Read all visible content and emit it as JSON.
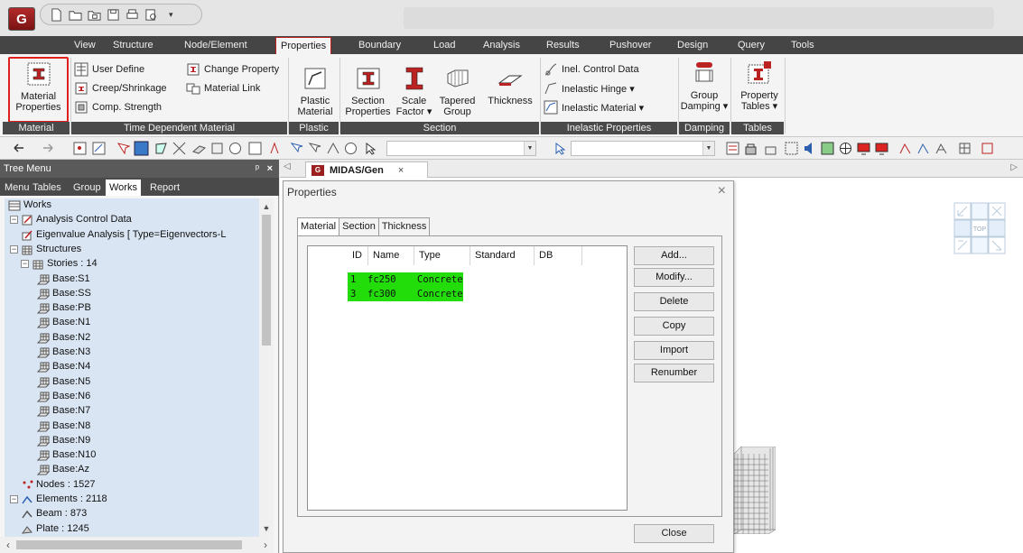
{
  "app": {
    "logo_text": "G",
    "title": ""
  },
  "quick_access": {
    "icons": [
      "new-file-icon",
      "open-folder-icon",
      "open-project-icon",
      "save-icon",
      "print-icon",
      "print-preview-icon"
    ],
    "more": "▾"
  },
  "ribbon_tabs": [
    "View",
    "Structure",
    "Node/Element",
    "Properties",
    "Boundary",
    "Load",
    "Analysis",
    "Results",
    "Pushover",
    "Design",
    "Query",
    "Tools"
  ],
  "ribbon": {
    "material_group": {
      "label": "Material",
      "btn_line1": "Material",
      "btn_line2": "Properties"
    },
    "time_dependent": {
      "label": "Time Dependent Material",
      "user_define": "User Define",
      "creep": "Creep/Shrinkage",
      "comp_strength": "Comp. Strength",
      "change_property": "Change Property",
      "material_link": "Material Link"
    },
    "plastic": {
      "label": "Plastic",
      "btn_line1": "Plastic",
      "btn_line2": "Material"
    },
    "section": {
      "label": "Section",
      "section_props_1": "Section",
      "section_props_2": "Properties",
      "scale_1": "Scale",
      "scale_2": "Factor ▾",
      "tapered_1": "Tapered",
      "tapered_2": "Group",
      "thickness": "Thickness"
    },
    "inelastic": {
      "label": "Inelastic Properties",
      "control": "Inel. Control Data",
      "hinge": "Inelastic Hinge ▾",
      "material": "Inelastic Material ▾"
    },
    "damping": {
      "label": "Damping",
      "btn_line1": "Group",
      "btn_line2": "Damping ▾"
    },
    "tables": {
      "label": "Tables",
      "btn_line1": "Property",
      "btn_line2": "Tables ▾"
    }
  },
  "tree_panel": {
    "title": "Tree Menu",
    "pin": "ᵖ",
    "close": "×",
    "tabs": [
      "Menu",
      "Tables",
      "Group",
      "Works",
      "Report"
    ],
    "active_tab": "Works",
    "nodes": [
      {
        "text": "Works",
        "level": 0,
        "icon": "works-icon",
        "expander": ""
      },
      {
        "text": "Analysis Control Data",
        "level": 1,
        "icon": "analysis-control-icon",
        "expander": "−"
      },
      {
        "text": "Eigenvalue Analysis [ Type=Eigenvectors-L",
        "level": 2,
        "icon": "eigenvalue-icon",
        "expander": ""
      },
      {
        "text": "Structures",
        "level": 1,
        "icon": "structures-icon",
        "expander": "−"
      },
      {
        "text": "Stories : 14",
        "level": 2,
        "icon": "stories-icon",
        "expander": "−"
      },
      {
        "text": "Base:S1",
        "level": 3,
        "icon": "story-icon",
        "expander": ""
      },
      {
        "text": "Base:SS",
        "level": 3,
        "icon": "story-icon",
        "expander": ""
      },
      {
        "text": "Base:PB",
        "level": 3,
        "icon": "story-icon",
        "expander": ""
      },
      {
        "text": "Base:N1",
        "level": 3,
        "icon": "story-icon",
        "expander": ""
      },
      {
        "text": "Base:N2",
        "level": 3,
        "icon": "story-icon",
        "expander": ""
      },
      {
        "text": "Base:N3",
        "level": 3,
        "icon": "story-icon",
        "expander": ""
      },
      {
        "text": "Base:N4",
        "level": 3,
        "icon": "story-icon",
        "expander": ""
      },
      {
        "text": "Base:N5",
        "level": 3,
        "icon": "story-icon",
        "expander": ""
      },
      {
        "text": "Base:N6",
        "level": 3,
        "icon": "story-icon",
        "expander": ""
      },
      {
        "text": "Base:N7",
        "level": 3,
        "icon": "story-icon",
        "expander": ""
      },
      {
        "text": "Base:N8",
        "level": 3,
        "icon": "story-icon",
        "expander": ""
      },
      {
        "text": "Base:N9",
        "level": 3,
        "icon": "story-icon",
        "expander": ""
      },
      {
        "text": "Base:N10",
        "level": 3,
        "icon": "story-icon",
        "expander": ""
      },
      {
        "text": "Base:Az",
        "level": 3,
        "icon": "story-icon",
        "expander": ""
      },
      {
        "text": "Nodes : 1527",
        "level": 2,
        "icon": "nodes-icon",
        "expander": ""
      },
      {
        "text": "Elements : 2118",
        "level": 1,
        "icon": "elements-icon",
        "expander": "−"
      },
      {
        "text": "Beam : 873",
        "level": 2,
        "icon": "beam-icon",
        "expander": ""
      },
      {
        "text": "Plate : 1245",
        "level": 2,
        "icon": "plate-icon",
        "expander": ""
      }
    ]
  },
  "doc_tab": {
    "label": "MIDAS/Gen",
    "close": "×",
    "logo": "G"
  },
  "dialog": {
    "title": "Properties",
    "close": "×",
    "tabs": [
      "Material",
      "Section",
      "Thickness"
    ],
    "active_tab": "Material",
    "columns": [
      "ID",
      "Name",
      "Type",
      "Standard",
      "DB"
    ],
    "rows": [
      {
        "id": "1",
        "name": "fc250",
        "type": "Concrete",
        "standard": "",
        "db": ""
      },
      {
        "id": "3",
        "name": "fc300",
        "type": "Concrete",
        "standard": "",
        "db": ""
      }
    ],
    "buttons": [
      "Add...",
      "Modify...",
      "Delete",
      "Copy",
      "Import",
      "Renumber"
    ],
    "close_button": "Close"
  },
  "viewcube": {
    "top_label": "TOP"
  },
  "colors": {
    "selected_row": "#22dd0a",
    "highlight_border": "#e0201e",
    "tab_bar": "#454545",
    "tree_bg": "#d9e5f3"
  }
}
